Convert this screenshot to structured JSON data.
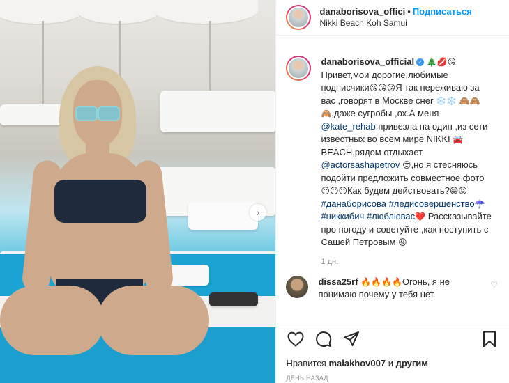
{
  "header": {
    "username": "danaborisova_offici",
    "separator": "•",
    "follow_label": "Подписаться",
    "location": "Nikki Beach Koh Samui"
  },
  "caption": {
    "username": "danaborisova_official",
    "verified_icon": "✓",
    "title_emoji": "🎄💋😘",
    "p1": "Привет,мои дорогие,любимые подписчики",
    "e1": "😘😘😘",
    "p2": "Я так переживаю за вас ,говорят в Москве снег",
    "e2": "❄️❄️",
    "e3": "🙈🙈🙈",
    "p3": ",даже сугробы ,ох.А меня ",
    "tag1": "@kate_rehab",
    "p4": " привезла на один ,из сети известных во всем мире NIKKI ",
    "e4": "🚘",
    "p5": " BEACH,рядом отдыхает ",
    "tag2": "@actorsashapetrov",
    "e5": "😍",
    "p6": ",но я стесняюсь подойти предложить совместное фото ",
    "e6": "😐😐😐",
    "p7": "Как будем действовать?",
    "e7": "😁😝",
    "tag3": "#данаборисова",
    "tag4": "#ледисовершенство",
    "e8": "☂️",
    "tag5": "#никкибич",
    "tag6": "#люблювас",
    "e9": "❤️",
    "p8": " Рассказывайте про погоду и советуйте ,как поступить с Сашей Петровым ",
    "e10": "😛"
  },
  "time": "1 дн.",
  "comment": {
    "username": "dissa25rf",
    "emoji": "🔥🔥🔥🔥",
    "text": "Огонь, я не понимаю почему у тебя нет"
  },
  "likes": {
    "prefix": "Нравится ",
    "user": "malakhov007",
    "mid": " и ",
    "others": "другим"
  },
  "posted_ago": "ДЕНЬ НАЗАД",
  "icons": {
    "carousel": "chevron-right-icon",
    "like": "heart-icon",
    "comment": "comment-icon",
    "share": "share-icon",
    "save": "bookmark-icon"
  },
  "colors": {
    "link": "#0095f6",
    "tag": "#00376b",
    "muted": "#8e8e8e",
    "verified": "#3897f0"
  }
}
